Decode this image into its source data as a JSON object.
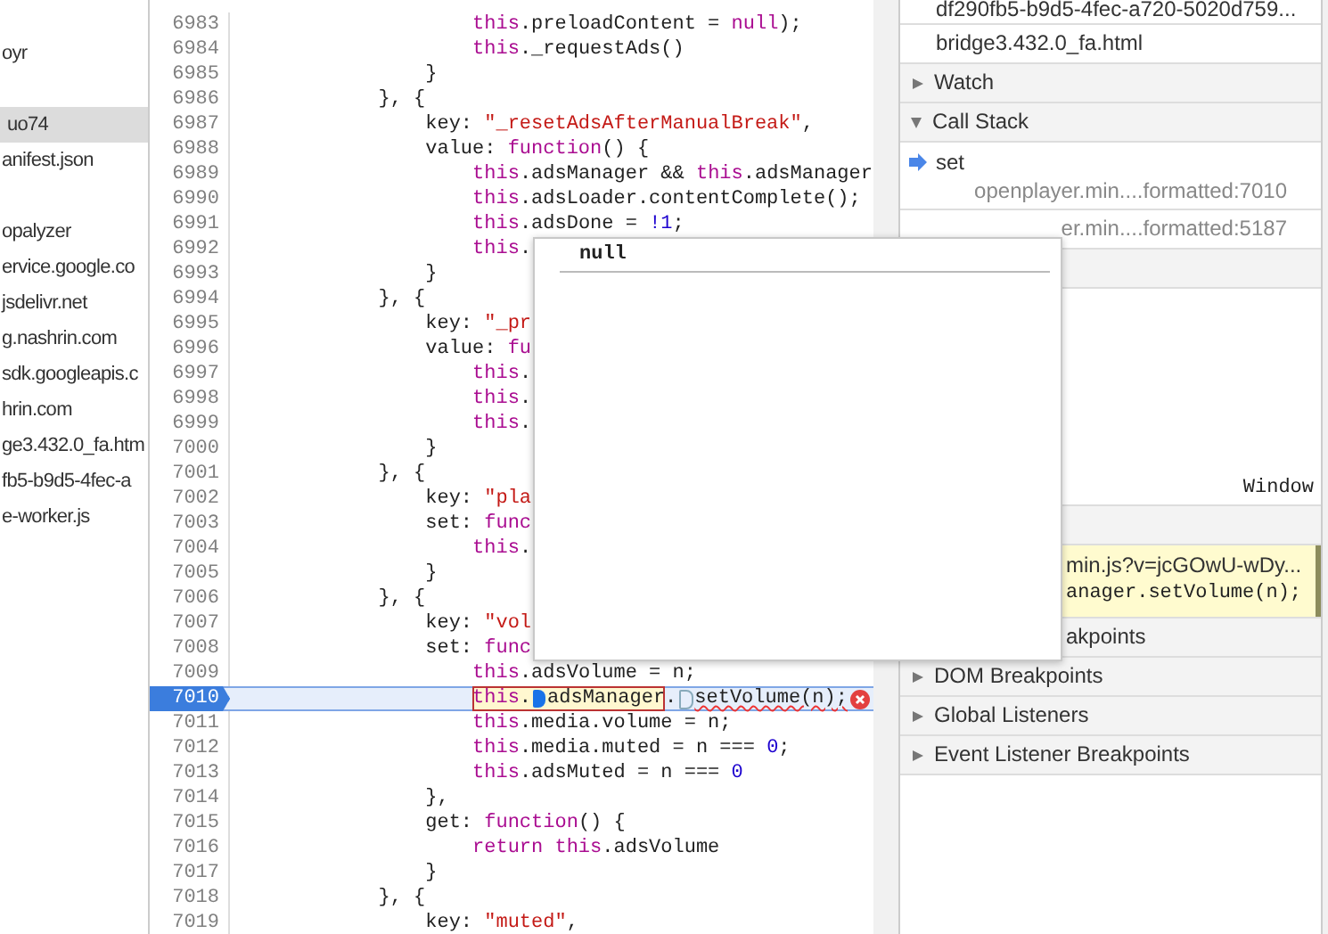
{
  "sidebar": {
    "groups": [
      [
        {
          "label": "oyr",
          "selected": false
        }
      ],
      [
        {
          "label": "uo74",
          "selected": true
        },
        {
          "label": "anifest.json",
          "selected": false
        }
      ],
      [
        {
          "label": "opalyzer",
          "selected": false
        },
        {
          "label": "ervice.google.co",
          "selected": false
        },
        {
          "label": "jsdelivr.net",
          "selected": false
        },
        {
          "label": "g.nashrin.com",
          "selected": false
        },
        {
          "label": "sdk.googleapis.c",
          "selected": false
        },
        {
          "label": "hrin.com",
          "selected": false
        },
        {
          "label": "ge3.432.0_fa.htm",
          "selected": false
        },
        {
          "label": "fb5-b9d5-4fec-a",
          "selected": false
        },
        {
          "label": "e-worker.js",
          "selected": false
        }
      ]
    ]
  },
  "editor": {
    "lines": [
      {
        "number": "6983",
        "current": false,
        "tokens": [
          {
            "kind": "keyword",
            "text": "                    this"
          },
          {
            "kind": "plain",
            "text": ".preloadContent = "
          },
          {
            "kind": "keyword",
            "text": "null"
          },
          {
            "kind": "plain",
            "text": ");"
          }
        ]
      },
      {
        "number": "6984",
        "current": false,
        "tokens": [
          {
            "kind": "keyword",
            "text": "                    this"
          },
          {
            "kind": "plain",
            "text": "._requestAds()"
          }
        ]
      },
      {
        "number": "6985",
        "current": false,
        "tokens": [
          {
            "kind": "plain",
            "text": "                }"
          }
        ]
      },
      {
        "number": "6986",
        "current": false,
        "tokens": [
          {
            "kind": "plain",
            "text": "            }, {"
          }
        ]
      },
      {
        "number": "6987",
        "current": false,
        "tokens": [
          {
            "kind": "plain",
            "text": "                key: "
          },
          {
            "kind": "string",
            "text": "\"_resetAdsAfterManualBreak\""
          },
          {
            "kind": "plain",
            "text": ","
          }
        ]
      },
      {
        "number": "6988",
        "current": false,
        "tokens": [
          {
            "kind": "plain",
            "text": "                value: "
          },
          {
            "kind": "keyword",
            "text": "function"
          },
          {
            "kind": "plain",
            "text": "() {"
          }
        ]
      },
      {
        "number": "6989",
        "current": false,
        "tokens": [
          {
            "kind": "keyword",
            "text": "                    this"
          },
          {
            "kind": "plain",
            "text": ".adsManager && "
          },
          {
            "kind": "keyword",
            "text": "this"
          },
          {
            "kind": "plain",
            "text": ".adsManager"
          }
        ]
      },
      {
        "number": "6990",
        "current": false,
        "tokens": [
          {
            "kind": "keyword",
            "text": "                    this"
          },
          {
            "kind": "plain",
            "text": ".adsLoader.contentComplete();"
          }
        ]
      },
      {
        "number": "6991",
        "current": false,
        "tokens": [
          {
            "kind": "keyword",
            "text": "                    this"
          },
          {
            "kind": "plain",
            "text": ".adsDone = "
          },
          {
            "kind": "number",
            "text": "!1"
          },
          {
            "kind": "plain",
            "text": ";"
          }
        ]
      },
      {
        "number": "6992",
        "current": false,
        "tokens": [
          {
            "kind": "keyword",
            "text": "                    this"
          },
          {
            "kind": "plain",
            "text": "."
          }
        ]
      },
      {
        "number": "6993",
        "current": false,
        "tokens": [
          {
            "kind": "plain",
            "text": "                }"
          }
        ]
      },
      {
        "number": "6994",
        "current": false,
        "tokens": [
          {
            "kind": "plain",
            "text": "            }, {"
          }
        ]
      },
      {
        "number": "6995",
        "current": false,
        "tokens": [
          {
            "kind": "plain",
            "text": "                key: "
          },
          {
            "kind": "string",
            "text": "\"_pr"
          }
        ]
      },
      {
        "number": "6996",
        "current": false,
        "tokens": [
          {
            "kind": "plain",
            "text": "                value: "
          },
          {
            "kind": "keyword",
            "text": "fu"
          }
        ]
      },
      {
        "number": "6997",
        "current": false,
        "tokens": [
          {
            "kind": "keyword",
            "text": "                    this"
          },
          {
            "kind": "plain",
            "text": "."
          }
        ]
      },
      {
        "number": "6998",
        "current": false,
        "tokens": [
          {
            "kind": "keyword",
            "text": "                    this"
          },
          {
            "kind": "plain",
            "text": "."
          }
        ]
      },
      {
        "number": "6999",
        "current": false,
        "tokens": [
          {
            "kind": "keyword",
            "text": "                    this"
          },
          {
            "kind": "plain",
            "text": "."
          }
        ]
      },
      {
        "number": "7000",
        "current": false,
        "tokens": [
          {
            "kind": "plain",
            "text": "                }"
          }
        ]
      },
      {
        "number": "7001",
        "current": false,
        "tokens": [
          {
            "kind": "plain",
            "text": "            }, {"
          }
        ]
      },
      {
        "number": "7002",
        "current": false,
        "tokens": [
          {
            "kind": "plain",
            "text": "                key: "
          },
          {
            "kind": "string",
            "text": "\"pla"
          }
        ]
      },
      {
        "number": "7003",
        "current": false,
        "tokens": [
          {
            "kind": "plain",
            "text": "                set: "
          },
          {
            "kind": "keyword",
            "text": "func"
          }
        ]
      },
      {
        "number": "7004",
        "current": false,
        "tokens": [
          {
            "kind": "keyword",
            "text": "                    this"
          },
          {
            "kind": "plain",
            "text": "."
          }
        ]
      },
      {
        "number": "7005",
        "current": false,
        "tokens": [
          {
            "kind": "plain",
            "text": "                }"
          }
        ]
      },
      {
        "number": "7006",
        "current": false,
        "tokens": [
          {
            "kind": "plain",
            "text": "            }, {"
          }
        ]
      },
      {
        "number": "7007",
        "current": false,
        "tokens": [
          {
            "kind": "plain",
            "text": "                key: "
          },
          {
            "kind": "string",
            "text": "\"vol"
          }
        ]
      },
      {
        "number": "7008",
        "current": false,
        "tokens": [
          {
            "kind": "plain",
            "text": "                set: "
          },
          {
            "kind": "keyword",
            "text": "func"
          }
        ]
      },
      {
        "number": "7009",
        "current": false,
        "tokens": [
          {
            "kind": "keyword",
            "text": "                    this"
          },
          {
            "kind": "plain",
            "text": ".adsVolume = n;"
          }
        ]
      },
      {
        "number": "7010",
        "current": true,
        "tokens": [
          {
            "kind": "expression",
            "parts": [
              {
                "kind": "keyword",
                "text": "this"
              },
              {
                "kind": "plain",
                "text": "."
              },
              {
                "kind": "exec-marker"
              },
              {
                "kind": "plain",
                "text": "adsManager"
              }
            ]
          },
          {
            "kind": "plain",
            "text": "."
          },
          {
            "kind": "breakpoint-marker"
          },
          {
            "kind": "error-text",
            "text": "setVolume(n);"
          },
          {
            "kind": "error-icon"
          }
        ]
      },
      {
        "number": "7011",
        "current": false,
        "tokens": [
          {
            "kind": "keyword",
            "text": "                    this"
          },
          {
            "kind": "plain",
            "text": ".media.volume = n;"
          }
        ]
      },
      {
        "number": "7012",
        "current": false,
        "tokens": [
          {
            "kind": "keyword",
            "text": "                    this"
          },
          {
            "kind": "plain",
            "text": ".media.muted = n === "
          },
          {
            "kind": "number",
            "text": "0"
          },
          {
            "kind": "plain",
            "text": ";"
          }
        ]
      },
      {
        "number": "7013",
        "current": false,
        "tokens": [
          {
            "kind": "keyword",
            "text": "                    this"
          },
          {
            "kind": "plain",
            "text": ".adsMuted = n === "
          },
          {
            "kind": "number",
            "text": "0"
          }
        ]
      },
      {
        "number": "7014",
        "current": false,
        "tokens": [
          {
            "kind": "plain",
            "text": "                },"
          }
        ]
      },
      {
        "number": "7015",
        "current": false,
        "tokens": [
          {
            "kind": "plain",
            "text": "                get: "
          },
          {
            "kind": "keyword",
            "text": "function"
          },
          {
            "kind": "plain",
            "text": "() {"
          }
        ]
      },
      {
        "number": "7016",
        "current": false,
        "tokens": [
          {
            "kind": "keyword",
            "text": "                    return this"
          },
          {
            "kind": "plain",
            "text": ".adsVolume"
          }
        ]
      },
      {
        "number": "7017",
        "current": false,
        "tokens": [
          {
            "kind": "plain",
            "text": "                }"
          }
        ]
      },
      {
        "number": "7018",
        "current": false,
        "tokens": [
          {
            "kind": "plain",
            "text": "            }, {"
          }
        ]
      },
      {
        "number": "7019",
        "current": false,
        "tokens": [
          {
            "kind": "plain",
            "text": "                key: "
          },
          {
            "kind": "string",
            "text": "\"muted\""
          },
          {
            "kind": "plain",
            "text": ","
          }
        ]
      }
    ]
  },
  "popover": {
    "value": "null"
  },
  "debugger": {
    "threads": [
      "df290fb5-b9d5-4fec-a720-5020d759...",
      "bridge3.432.0_fa.html"
    ],
    "sections": [
      {
        "kind": "header",
        "title": "Watch",
        "expanded": false
      },
      {
        "kind": "header",
        "title": "Call Stack",
        "expanded": true
      },
      {
        "kind": "frame",
        "name": "set",
        "location": "openplayer.min....formatted:7010",
        "current": true
      },
      {
        "kind": "frame",
        "location": "er.min....formatted:5187",
        "current": false
      },
      {
        "kind": "covered"
      },
      {
        "kind": "scope",
        "value": "Window"
      },
      {
        "kind": "covered"
      },
      {
        "kind": "breakpoint",
        "file": "min.js?v=jcGOwU-wDy...",
        "code": "anager.setVolume(n);",
        "hit": true
      },
      {
        "kind": "partial",
        "title": "akpoints"
      },
      {
        "kind": "header",
        "title": "DOM Breakpoints",
        "expanded": false
      },
      {
        "kind": "header",
        "title": "Global Listeners",
        "expanded": false
      },
      {
        "kind": "header",
        "title": "Event Listener Breakpoints",
        "expanded": false
      }
    ]
  }
}
